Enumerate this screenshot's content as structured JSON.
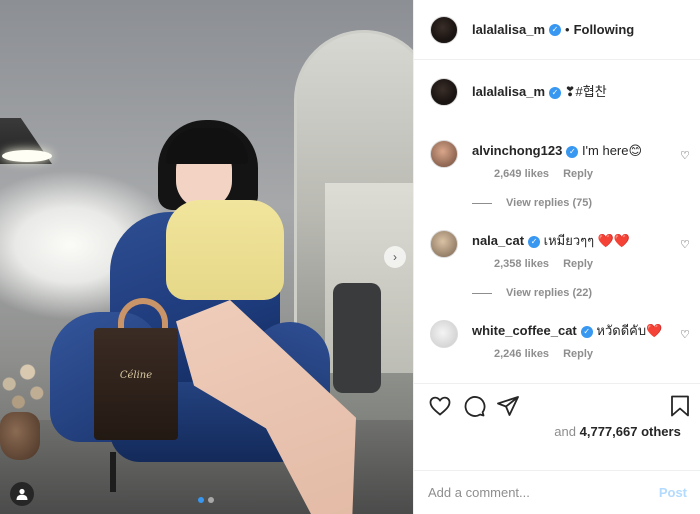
{
  "post": {
    "author": "lalalalisa_m",
    "follow_status": "Following",
    "caption_text": "❣#협찬",
    "bag_brand": "Céline",
    "carousel": {
      "slide_count": 2,
      "active_index": 0
    }
  },
  "comments": [
    {
      "user": "alvinchong123",
      "verified": true,
      "text": "I'm here😊",
      "likes": "2,649 likes",
      "reply": "Reply",
      "view_replies": "View replies (75)"
    },
    {
      "user": "nala_cat",
      "verified": true,
      "text": "เหมียวๆๆ ❤️❤️",
      "likes": "2,358 likes",
      "reply": "Reply",
      "view_replies": "View replies (22)"
    },
    {
      "user": "white_coffee_cat",
      "verified": true,
      "text": "หวัดดีคับ❤️",
      "likes": "2,246 likes",
      "reply": "Reply"
    }
  ],
  "likes_summary": {
    "prefix": "and",
    "count": "4,777,667 others"
  },
  "add_comment": {
    "placeholder": "Add a comment...",
    "post_label": "Post"
  },
  "icons": {
    "like": "heart-icon",
    "comment": "comment-icon",
    "share": "share-icon",
    "save": "bookmark-icon",
    "tag": "user-tag-icon",
    "next": "chevron-right-icon"
  },
  "colors": {
    "accent": "#3897f0",
    "post_disabled": "#b3dbff",
    "muted": "#8e8e8e",
    "text": "#262626"
  }
}
